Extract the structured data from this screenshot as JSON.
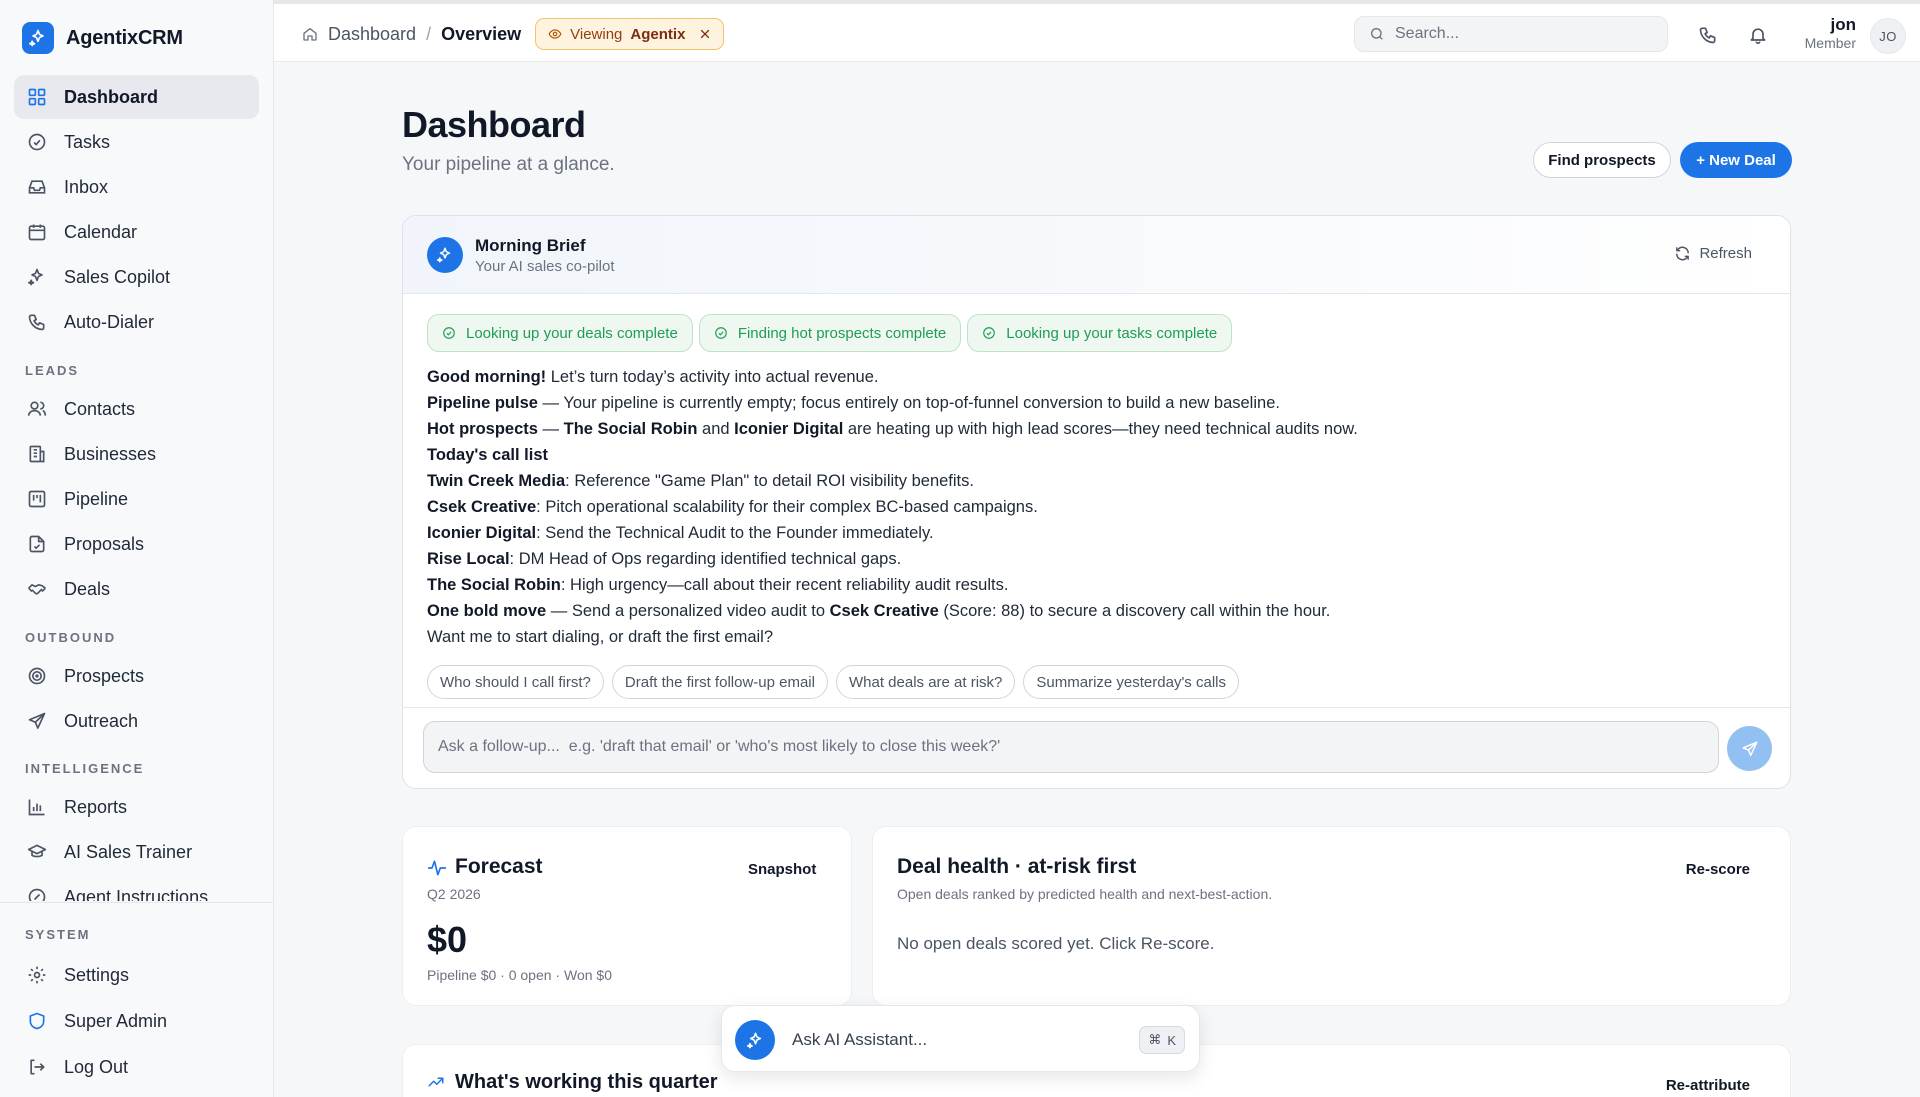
{
  "app": {
    "name": "AgentixCRM"
  },
  "sidebar": {
    "primary": [
      {
        "label": "Dashboard",
        "icon": "grid-icon"
      },
      {
        "label": "Tasks",
        "icon": "check-circle-icon"
      },
      {
        "label": "Inbox",
        "icon": "inbox-icon"
      },
      {
        "label": "Calendar",
        "icon": "calendar-icon"
      },
      {
        "label": "Sales Copilot",
        "icon": "sparkles-icon"
      },
      {
        "label": "Auto-Dialer",
        "icon": "phone-icon"
      }
    ],
    "leads_label": "LEADS",
    "leads": [
      {
        "label": "Contacts",
        "icon": "users-icon"
      },
      {
        "label": "Businesses",
        "icon": "building-icon"
      },
      {
        "label": "Pipeline",
        "icon": "kanban-icon"
      },
      {
        "label": "Proposals",
        "icon": "file-icon"
      },
      {
        "label": "Deals",
        "icon": "handshake-icon"
      }
    ],
    "outbound_label": "OUTBOUND",
    "outbound": [
      {
        "label": "Prospects",
        "icon": "target-icon"
      },
      {
        "label": "Outreach",
        "icon": "send-icon"
      }
    ],
    "intelligence_label": "INTELLIGENCE",
    "intelligence": [
      {
        "label": "Reports",
        "icon": "bar-chart-icon"
      },
      {
        "label": "AI Sales Trainer",
        "icon": "graduation-cap-icon"
      },
      {
        "label": "Agent Instructions",
        "icon": "bot-icon"
      }
    ],
    "system_label": "SYSTEM",
    "system": [
      {
        "label": "Settings",
        "icon": "gear-icon"
      },
      {
        "label": "Super Admin",
        "icon": "shield-icon"
      },
      {
        "label": "Log Out",
        "icon": "logout-icon"
      }
    ]
  },
  "header": {
    "crumb_home": "Dashboard",
    "crumb_sep": "/",
    "crumb_current": "Overview",
    "viewing_prefix": "Viewing",
    "viewing_name": "Agentix",
    "search_placeholder": "Search...",
    "user_name": "jon",
    "user_role": "Member",
    "user_initials": "JO"
  },
  "page": {
    "title": "Dashboard",
    "subtitle": "Your pipeline at a glance.",
    "find_prospects": "Find prospects",
    "new_deal": "+ New Deal"
  },
  "brief": {
    "title": "Morning Brief",
    "subtitle": "Your AI sales co-pilot",
    "refresh": "Refresh",
    "status_chips": [
      "Looking up your deals complete",
      "Finding hot prospects complete",
      "Looking up your tasks complete"
    ],
    "line1_bold": "Good morning!",
    "line1_rest": " Let’s turn today’s activity into actual revenue.",
    "line2_bold": "Pipeline pulse",
    "line2_rest": " — Your pipeline is currently empty; focus entirely on top-of-funnel conversion to build a new baseline.",
    "line3_bold": "Hot prospects",
    "line3_mid1": " — ",
    "line3_b2": "The Social Robin",
    "line3_mid2": " and ",
    "line3_b3": "Iconier Digital",
    "line3_rest": " are heating up with high lead scores—they need technical audits now.",
    "call_list_heading": "Today's call list",
    "call_list": [
      {
        "name": "Twin Creek Media",
        "note": ": Reference \"Game Plan\" to detail ROI visibility benefits."
      },
      {
        "name": "Csek Creative",
        "note": ": Pitch operational scalability for their complex BC-based campaigns."
      },
      {
        "name": "Iconier Digital",
        "note": ": Send the Technical Audit to the Founder immediately."
      },
      {
        "name": "Rise Local",
        "note": ": DM Head of Ops regarding identified technical gaps."
      },
      {
        "name": "The Social Robin",
        "note": ": High urgency—call about their recent reliability audit results."
      }
    ],
    "bold_move_label": "One bold move",
    "bold_move_pre": " — Send a personalized video audit to ",
    "bold_move_company": "Csek Creative",
    "bold_move_post": " (Score: 88) to secure a discovery call within the hour.",
    "closing": "Want me to start dialing, or draft the first email?",
    "suggestions": [
      "Who should I call first?",
      "Draft the first follow-up email",
      "What deals are at risk?",
      "Summarize yesterday's calls"
    ],
    "ask_placeholder": "Ask a follow-up...  e.g. 'draft that email' or 'who's most likely to close this week?'"
  },
  "forecast": {
    "title": "Forecast",
    "period": "Q2 2026",
    "action": "Snapshot",
    "value": "$0",
    "meta": "Pipeline $0 · 0 open · Won $0"
  },
  "deal_health": {
    "title": "Deal health · at-risk first",
    "subtitle": "Open deals ranked by predicted health and next-best-action.",
    "action": "Re-score",
    "empty": "No open deals scored yet. Click Re-score."
  },
  "working": {
    "title": "What's working this quarter",
    "action": "Re-attribute"
  },
  "assistant": {
    "label": "Ask AI Assistant...",
    "shortcut_symbol": "⌘",
    "shortcut_key": "K"
  },
  "colors": {
    "accent": "#1d74e7",
    "success": "#1f9d55",
    "warning_bg": "#fdf3df"
  }
}
